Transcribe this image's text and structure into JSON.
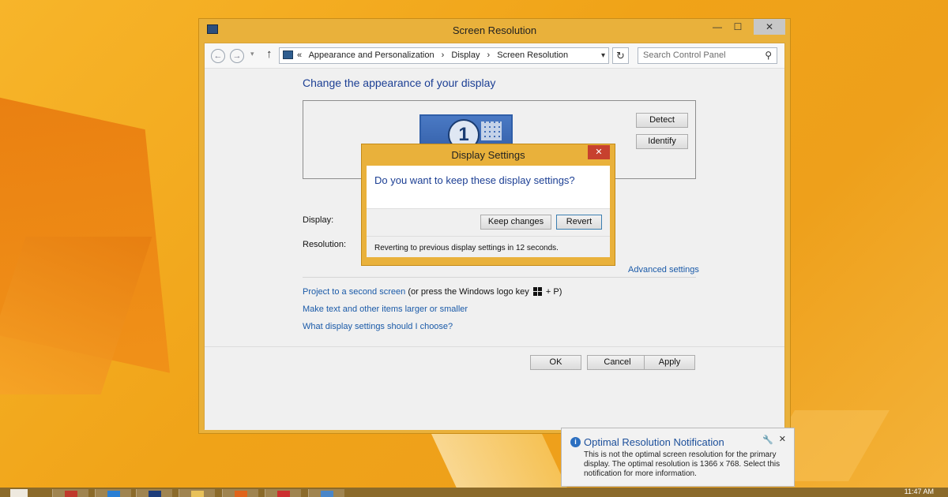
{
  "window": {
    "title": "Screen Resolution",
    "min_glyph": "—",
    "max_glyph": "☐",
    "close_glyph": "✕"
  },
  "navbar": {
    "back_glyph": "←",
    "forward_glyph": "→",
    "dropdown_glyph": "▾",
    "up_glyph": "↑",
    "breadcrumb_prefix": "«",
    "breadcrumbs": [
      "Appearance and Personalization",
      "Display",
      "Screen Resolution"
    ],
    "breadcrumb_sep": "›",
    "address_dropdown_glyph": "▾",
    "refresh_glyph": "↻",
    "search_placeholder": "Search Control Panel",
    "search_glyph": "⚲"
  },
  "content": {
    "heading": "Change the appearance of your display",
    "monitor_number": "1",
    "detect_label": "Detect",
    "identify_label": "Identify",
    "display_label": "Display:",
    "resolution_label": "Resolution:",
    "advanced_link": "Advanced settings",
    "link_project": "Project to a second screen",
    "link_project_suffix_a": "(or press the Windows logo key",
    "link_project_suffix_b": "+ P)",
    "link_text_size": "Make text and other items larger or smaller",
    "link_what_settings": "What display settings should I choose?"
  },
  "footer": {
    "ok_label": "OK",
    "cancel_label": "Cancel",
    "apply_label": "Apply"
  },
  "dialog": {
    "title": "Display Settings",
    "close_glyph": "✕",
    "question": "Do you want to keep these display settings?",
    "keep_label": "Keep changes",
    "revert_label": "Revert",
    "status": "Reverting to previous display settings in 12 seconds."
  },
  "toast": {
    "info_glyph": "i",
    "title": "Optimal Resolution Notification",
    "wrench_glyph": "🔧",
    "close_glyph": "✕",
    "body": "This is not the optimal screen resolution for the primary display. The optimal resolution is 1366 x 768. Select this notification for more information."
  },
  "taskbar": {
    "clock": "11:47 AM",
    "apps": [
      {
        "name": "metro-app",
        "color": "#c0392b"
      },
      {
        "name": "internet-explorer",
        "color": "#2a7fd4"
      },
      {
        "name": "powershell",
        "color": "#1f3d7a"
      },
      {
        "name": "file-explorer",
        "color": "#e8c15a"
      },
      {
        "name": "firefox",
        "color": "#e0641b"
      },
      {
        "name": "chrome",
        "color": "#cc2f2f"
      },
      {
        "name": "control-panel",
        "color": "#4a86c8"
      }
    ]
  },
  "colors": {
    "accent": "#e9b13b",
    "heading": "#1c3f94",
    "link": "#1a5aa8",
    "close_red": "#c7412e"
  }
}
